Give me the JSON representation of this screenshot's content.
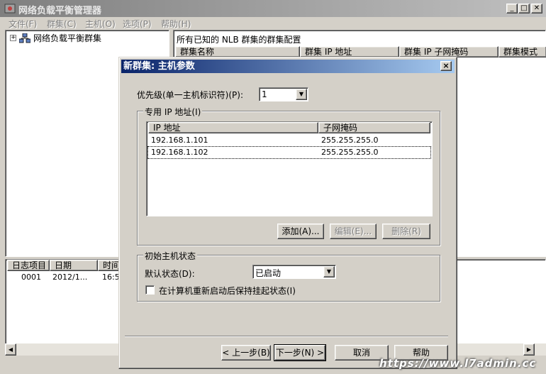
{
  "window": {
    "title": "网络负载平衡管理器"
  },
  "menu": [
    "文件(F)",
    "群集(C)",
    "主机(O)",
    "选项(P)",
    "帮助(H)"
  ],
  "tree": {
    "root_label": "网络负载平衡群集"
  },
  "cluster_list": {
    "title": "所有已知的 NLB 群集的群集配置",
    "columns": [
      "群集名称",
      "群集 IP 地址",
      "群集 IP 子网掩码",
      "群集模式"
    ]
  },
  "log": {
    "columns": [
      "日志项目",
      "日期",
      "时间"
    ],
    "rows": [
      {
        "item": "0001",
        "date": "2012/1...",
        "time": "16:5"
      }
    ]
  },
  "dialog": {
    "title": "新群集:  主机参数",
    "priority_label": "优先级(单一主机标识符)(P):",
    "priority_value": "1",
    "dedicated_group_label": "专用 IP 地址(I)",
    "ip_columns": [
      "IP 地址",
      "子网掩码"
    ],
    "ip_rows": [
      {
        "ip": "192.168.1.101",
        "mask": "255.255.255.0"
      },
      {
        "ip": "192.168.1.102",
        "mask": "255.255.255.0"
      }
    ],
    "add_label": "添加(A)...",
    "edit_label": "编辑(E)...",
    "remove_label": "删除(R)",
    "initial_state_group_label": "初始主机状态",
    "default_state_label": "默认状态(D):",
    "default_state_value": "已启动",
    "retain_suspended_label": "在计算机重新启动后保持挂起状态(I)",
    "back_label": "< 上一步(B)",
    "next_label": "下一步(N) >",
    "cancel_label": "取消",
    "help_label": "帮助"
  },
  "watermark": "https://www.l7admin.cc"
}
